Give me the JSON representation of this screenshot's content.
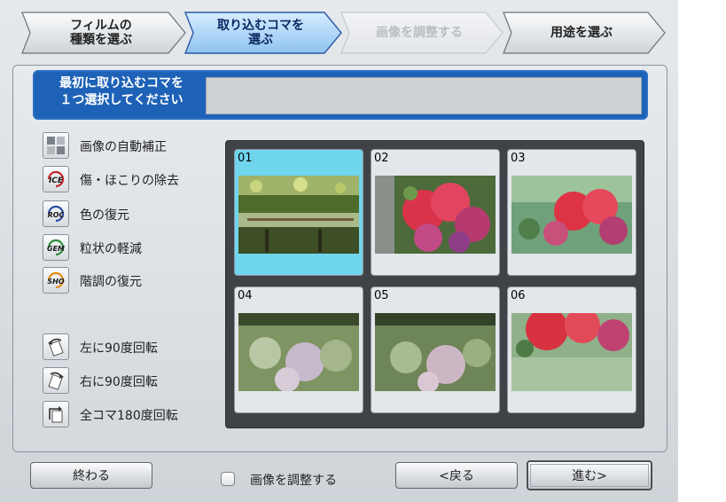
{
  "steps": [
    {
      "label": "フィルムの\n種類を選ぶ",
      "state": "done"
    },
    {
      "label": "取り込むコマを\n選ぶ",
      "state": "active"
    },
    {
      "label": "画像を調整する",
      "state": "disabled"
    },
    {
      "label": "用途を選ぶ",
      "state": "normal"
    }
  ],
  "instruction": "最初に取り込むコマを\n１つ選択してください",
  "tools": [
    {
      "icon": "auto-correct-icon",
      "label": "画像の自動補正"
    },
    {
      "icon": "ice-icon",
      "label": "傷・ほこりの除去",
      "badge": "ICE"
    },
    {
      "icon": "roc-icon",
      "label": "色の復元",
      "badge": "ROC"
    },
    {
      "icon": "gem-icon",
      "label": "粒状の軽減",
      "badge": "GEM"
    },
    {
      "icon": "sho-icon",
      "label": "階調の復元",
      "badge": "SHO"
    }
  ],
  "rotate": [
    {
      "icon": "rotate-left-icon",
      "label": "左に90度回転"
    },
    {
      "icon": "rotate-right-icon",
      "label": "右に90度回転"
    },
    {
      "icon": "rotate-180-icon",
      "label": "全コマ180度回転"
    }
  ],
  "frames": [
    {
      "num": "01",
      "selected": true
    },
    {
      "num": "02",
      "selected": false
    },
    {
      "num": "03",
      "selected": false
    },
    {
      "num": "04",
      "selected": false
    },
    {
      "num": "05",
      "selected": false
    },
    {
      "num": "06",
      "selected": false
    }
  ],
  "bottom": {
    "exit_label": "終わる",
    "adjust_label": "画像を調整する",
    "adjust_checked": false,
    "back_label": "<戻る",
    "next_label": "進む>"
  },
  "colors": {
    "accent": "#1e62b7",
    "selected_frame": "#6fd6ee",
    "grid_bg": "#3f4347"
  }
}
